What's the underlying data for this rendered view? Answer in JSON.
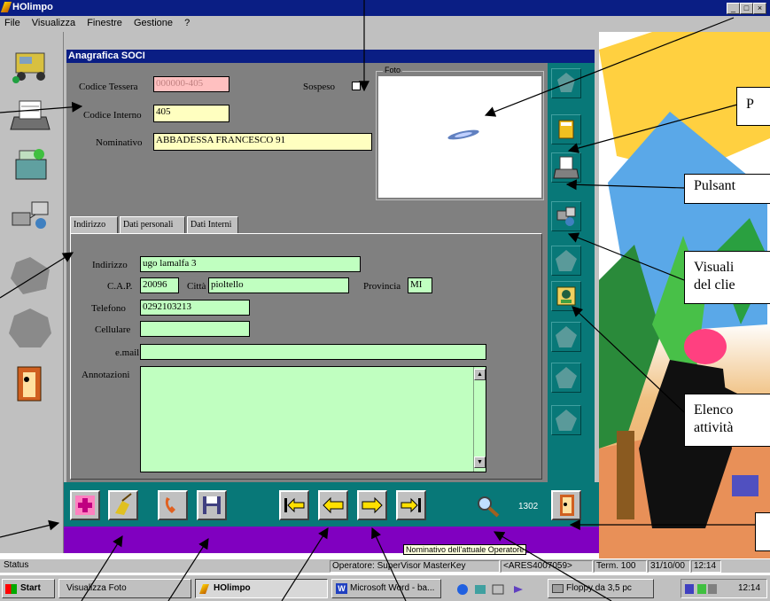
{
  "app": {
    "title": "HOlimpo"
  },
  "menu": [
    "File",
    "Visualizza",
    "Finestre",
    "Gestione",
    "?"
  ],
  "form": {
    "title": "Anagrafica SOCI",
    "codice_tessera_label": "Codice Tessera",
    "codice_tessera": "000000-405",
    "sospeso_label": "Sospeso",
    "codice_interno_label": "Codice Interno",
    "codice_interno": "405",
    "nominativo_label": "Nominativo",
    "nominativo": "ABBADESSA FRANCESCO 91",
    "foto_label": "Foto"
  },
  "tabs": [
    "Indirizzo",
    "Dati personali",
    "Dati Interni"
  ],
  "address": {
    "indirizzo_label": "Indirizzo",
    "indirizzo": "ugo lamalfa 3",
    "cap_label": "C.A.P.",
    "cap": "20096",
    "citta_label": "Città",
    "citta": "pioltello",
    "provincia_label": "Provincia",
    "provincia": "MI",
    "telefono_label": "Telefono",
    "telefono": "0292103213",
    "cellulare_label": "Cellulare",
    "cellulare": "",
    "email_label": "e.mail",
    "email": "",
    "annotazioni_label": "Annotazioni",
    "annotazioni": ""
  },
  "toolbar": {
    "operator_code": "1302",
    "tooltip": "Nominativo dell'attuale Operatore"
  },
  "status": {
    "text": "Status",
    "operator": "Operatore: SuperVisor MasterKey",
    "code": "<ARES4007059>",
    "terminal": "Term. 100",
    "date": "31/10/00",
    "time": "12:14"
  },
  "taskbar": {
    "start": "Start",
    "tasks": [
      "Visualizza Foto",
      "HOlimpo",
      "Microsoft Word - ba...",
      "Floppy da 3,5 pc"
    ],
    "clock": "12:14"
  },
  "callouts": [
    "P",
    "Pulsant",
    "Visuali",
    "del clie",
    "Elenco",
    "attività"
  ],
  "colors": {
    "titlebar": "#0a1e84",
    "field_yellow": "#ffffc0",
    "field_green": "#c0ffc0",
    "field_pink": "#ffc0c0",
    "toolbar_teal": "#087878",
    "footer_purple": "#8000c0"
  }
}
